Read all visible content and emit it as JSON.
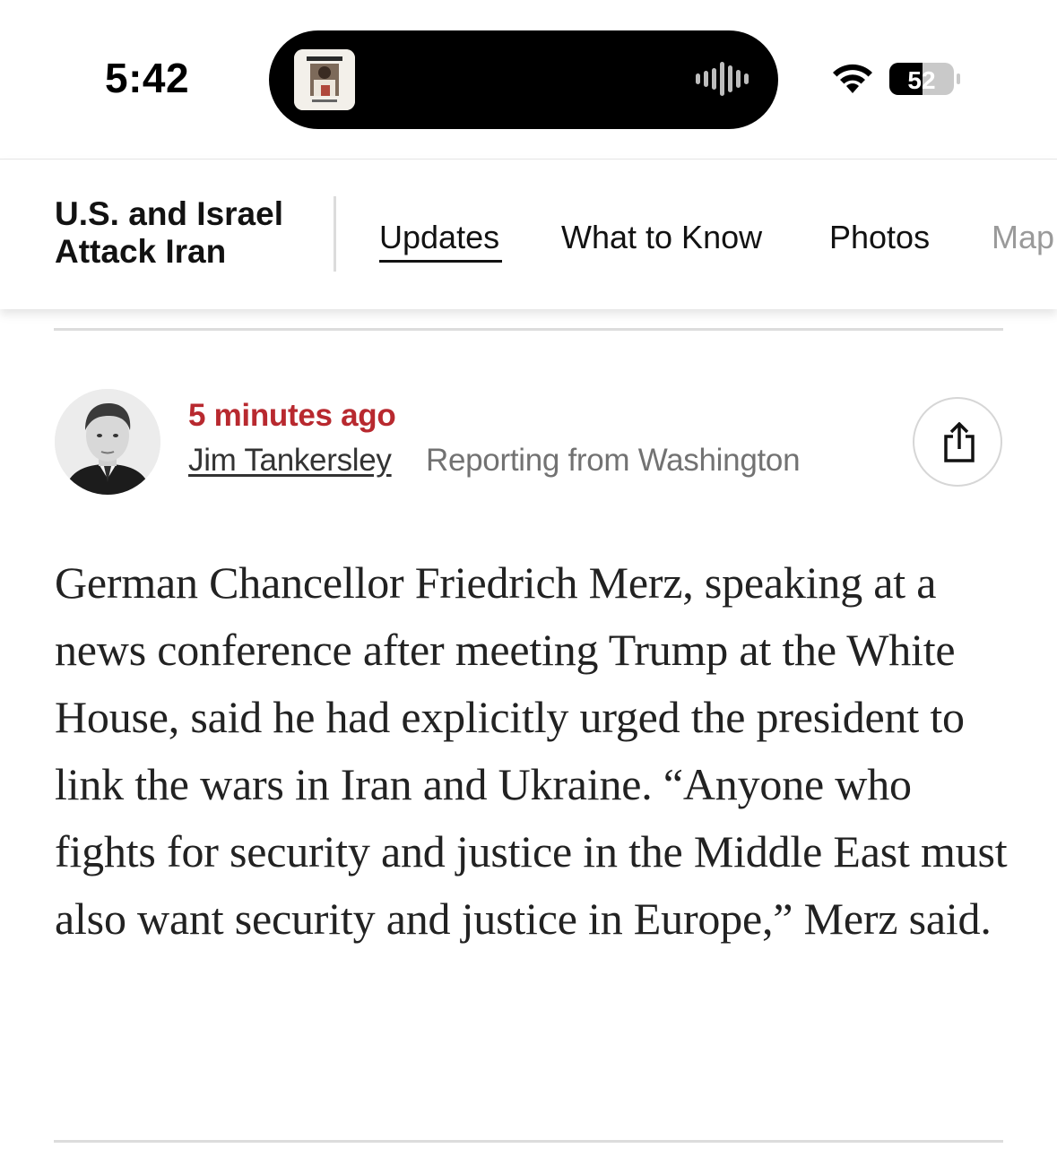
{
  "status_bar": {
    "time": "5:42",
    "battery_level": "52",
    "icons": [
      "album-art-icon",
      "audio-waveform-icon",
      "wifi-icon",
      "battery-icon"
    ]
  },
  "nav": {
    "section_title": "U.S. and Israel Attack Iran",
    "tabs": [
      {
        "label": "Updates",
        "active": true
      },
      {
        "label": "What to Know",
        "active": false
      },
      {
        "label": "Photos",
        "active": false
      },
      {
        "label": "Map",
        "active": false
      }
    ]
  },
  "post": {
    "timestamp": "5 minutes ago",
    "author": "Jim Tankersley",
    "dateline": "Reporting from Washington",
    "share_icon": "share-icon",
    "body": "German Chancellor Friedrich Merz, speaking at a news conference after meeting Trump at the White House, said he had explicitly urged the president to link the wars in Iran and Ukraine. “Anyone who fights for security and justice in the Middle East must also want security and justice in Europe,” Merz said."
  },
  "colors": {
    "timestamp": "#b8292f",
    "divider": "#dcdcdc",
    "island": "#000000"
  }
}
